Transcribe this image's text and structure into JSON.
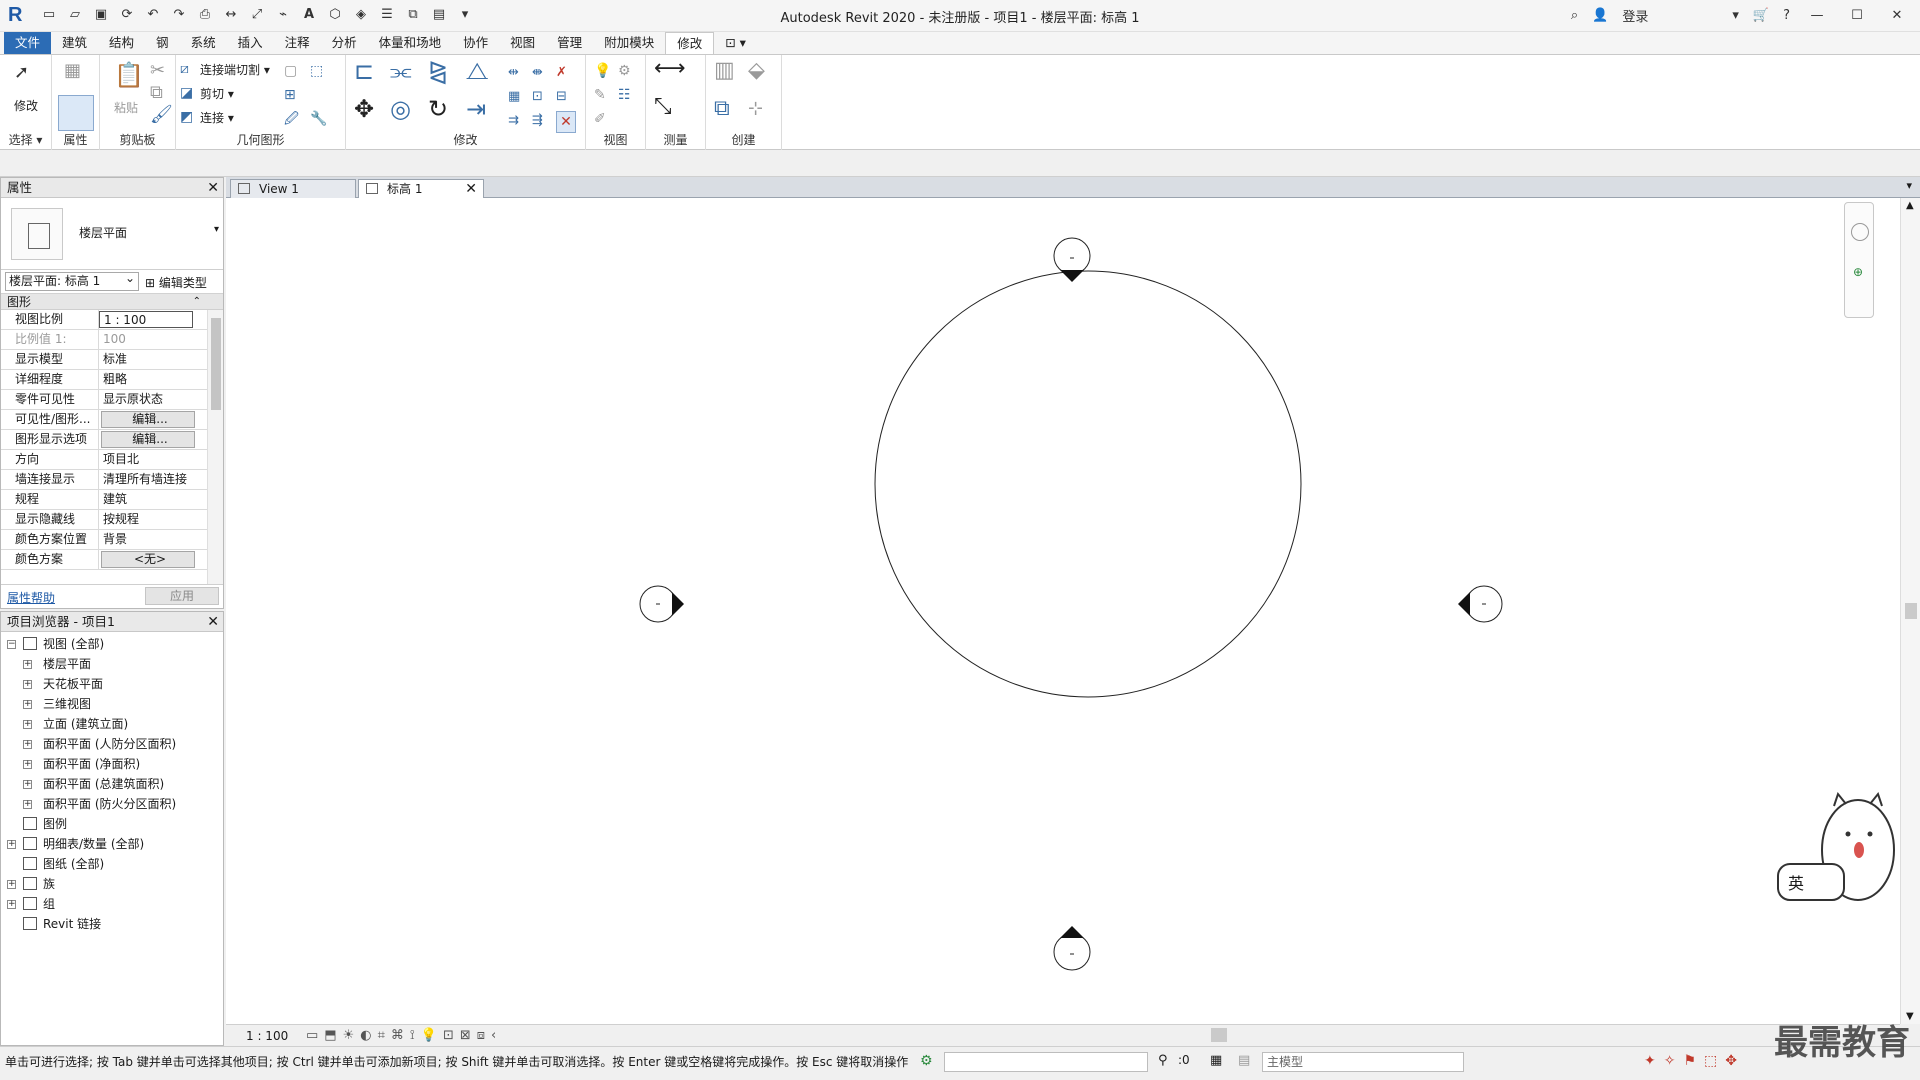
{
  "window": {
    "title": "Autodesk Revit 2020 - 未注册版 - 项目1 - 楼层平面: 标高 1",
    "login": "登录",
    "logo": "R"
  },
  "ribbon": {
    "tabs": [
      "文件",
      "建筑",
      "结构",
      "钢",
      "系统",
      "插入",
      "注释",
      "分析",
      "体量和场地",
      "协作",
      "视图",
      "管理",
      "附加模块",
      "修改"
    ],
    "active_tab": "修改",
    "groups": {
      "select": "选择",
      "properties": "属性",
      "clipboard": "剪贴板",
      "geometry": "几何图形",
      "modify": "修改",
      "view": "视图",
      "measure": "测量",
      "create": "创建"
    },
    "modify_label": "修改",
    "paste_label": "粘贴",
    "cut_join": "连接端切割",
    "cut": "剪切",
    "join": "连接"
  },
  "properties": {
    "title": "属性",
    "type_name": "楼层平面",
    "instance": "楼层平面: 标高 1",
    "edit_type": "编辑类型",
    "category": "图形",
    "rows": [
      {
        "k": "视图比例",
        "v": "1 : 100",
        "style": "input"
      },
      {
        "k": "比例值 1:",
        "v": "100",
        "style": "disabled"
      },
      {
        "k": "显示模型",
        "v": "标准",
        "style": ""
      },
      {
        "k": "详细程度",
        "v": "粗略",
        "style": ""
      },
      {
        "k": "零件可见性",
        "v": "显示原状态",
        "style": ""
      },
      {
        "k": "可见性/图形...",
        "v": "编辑...",
        "style": "btn"
      },
      {
        "k": "图形显示选项",
        "v": "编辑...",
        "style": "btn"
      },
      {
        "k": "方向",
        "v": "项目北",
        "style": ""
      },
      {
        "k": "墙连接显示",
        "v": "清理所有墙连接",
        "style": ""
      },
      {
        "k": "规程",
        "v": "建筑",
        "style": ""
      },
      {
        "k": "显示隐藏线",
        "v": "按规程",
        "style": ""
      },
      {
        "k": "颜色方案位置",
        "v": "背景",
        "style": ""
      },
      {
        "k": "颜色方案",
        "v": "<无>",
        "style": "btn"
      }
    ],
    "help": "属性帮助",
    "apply": "应用"
  },
  "browser": {
    "title": "项目浏览器 - 项目1",
    "nodes": [
      {
        "label": "视图 (全部)",
        "level": 0,
        "exp": "−"
      },
      {
        "label": "楼层平面",
        "level": 1,
        "exp": "+"
      },
      {
        "label": "天花板平面",
        "level": 1,
        "exp": "+"
      },
      {
        "label": "三维视图",
        "level": 1,
        "exp": "+"
      },
      {
        "label": "立面 (建筑立面)",
        "level": 1,
        "exp": "+"
      },
      {
        "label": "面积平面 (人防分区面积)",
        "level": 1,
        "exp": "+"
      },
      {
        "label": "面积平面 (净面积)",
        "level": 1,
        "exp": "+"
      },
      {
        "label": "面积平面 (总建筑面积)",
        "level": 1,
        "exp": "+"
      },
      {
        "label": "面积平面 (防火分区面积)",
        "level": 1,
        "exp": "+"
      },
      {
        "label": "图例",
        "level": 0,
        "exp": ""
      },
      {
        "label": "明细表/数量 (全部)",
        "level": 0,
        "exp": "+"
      },
      {
        "label": "图纸 (全部)",
        "level": 0,
        "exp": ""
      },
      {
        "label": "族",
        "level": 0,
        "exp": "+"
      },
      {
        "label": "组",
        "level": 0,
        "exp": "+"
      },
      {
        "label": "Revit 链接",
        "level": 0,
        "exp": ""
      }
    ]
  },
  "view_tabs": [
    {
      "label": "View 1",
      "active": false
    },
    {
      "label": "标高 1",
      "active": true
    }
  ],
  "view_control": {
    "scale": "1 : 100"
  },
  "status": {
    "message": "单击可进行选择; 按 Tab 键并单击可选择其他项目; 按 Ctrl 键并单击可添加新项目; 按 Shift 键并单击可取消选择。按 Enter 键或空格键将完成操作。按 Esc 键将取消操作",
    "selection_count": ":0",
    "model": "主模型"
  },
  "ime": {
    "label": "英"
  },
  "watermark": "最需教育",
  "colors": {
    "accent": "#2c6cb5",
    "link": "#1f5aa6"
  }
}
